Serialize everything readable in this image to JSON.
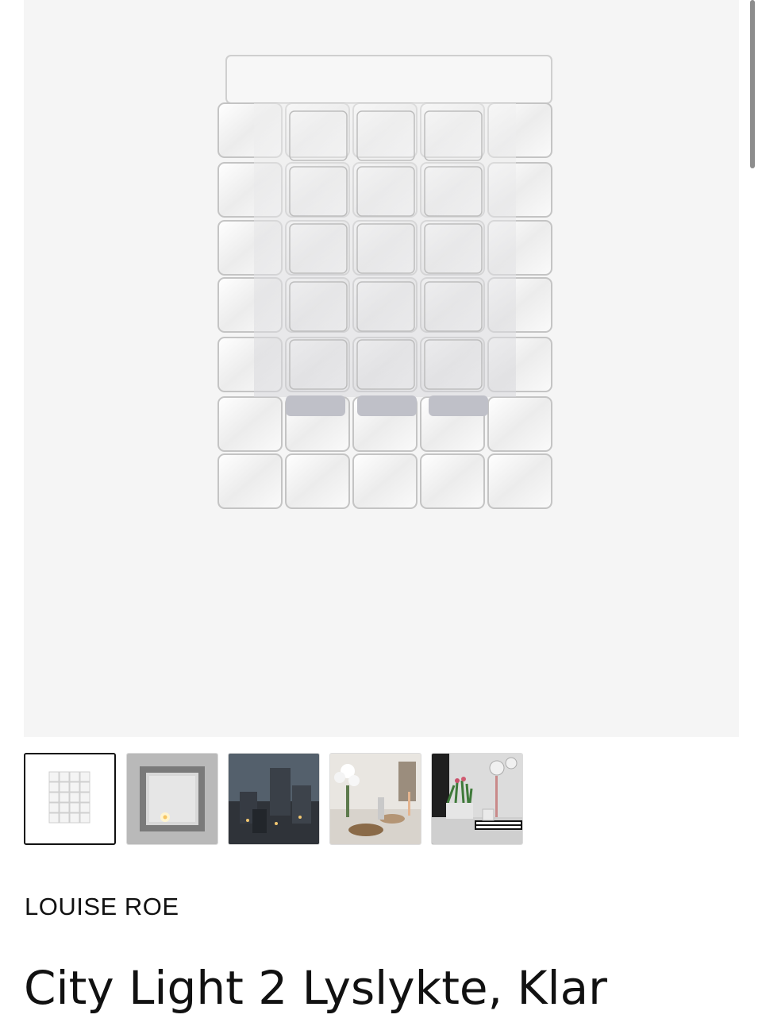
{
  "product": {
    "brand": "LOUISE ROE",
    "title": "City Light 2 Lyslykte, Klar",
    "main_image": "glass-grid-candle-holder"
  },
  "gallery": {
    "selected_index": 0,
    "thumbnails": [
      {
        "image": "candle-holder-front"
      },
      {
        "image": "candle-holder-top-view-lit"
      },
      {
        "image": "city-skyline-lanterns-dark"
      },
      {
        "image": "table-setting-with-flowers"
      },
      {
        "image": "tulips-and-candle-holder-on-tray"
      }
    ]
  },
  "colors": {
    "hero_bg": "#f5f5f5",
    "text": "#111111",
    "active_thumb_border": "#111111"
  }
}
